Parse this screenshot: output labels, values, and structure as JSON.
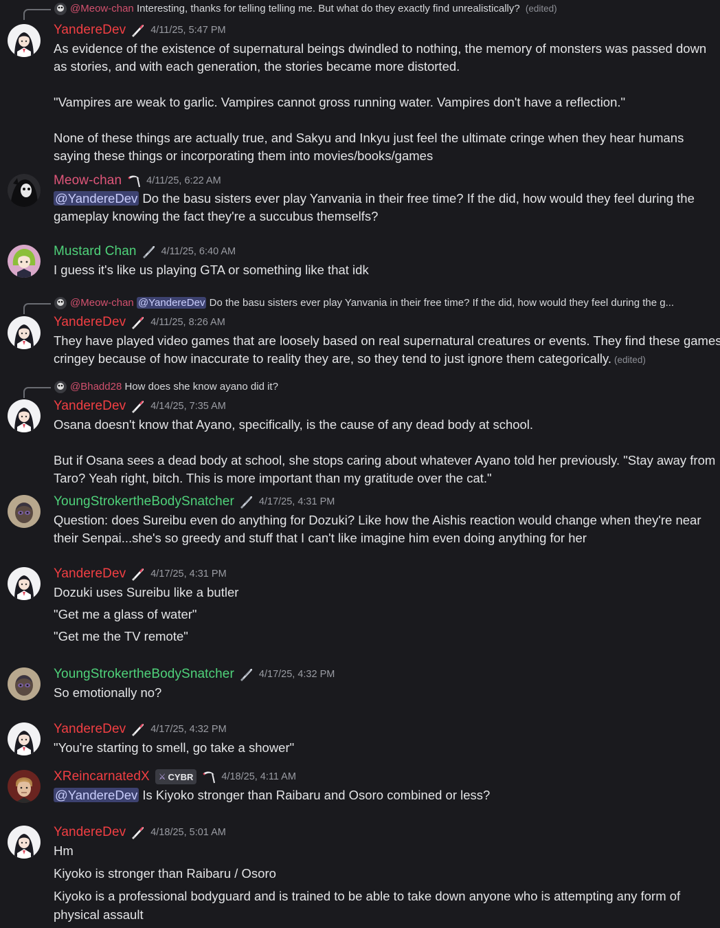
{
  "colors": {
    "yanderedev": "#f23f43",
    "meowchan": "#e0567a",
    "mustard": "#4fd27a",
    "youngstroker": "#4fd27a",
    "xreincarnated": "#f23f43",
    "mention_bg": "#3d4270"
  },
  "replies": [
    {
      "name": "@Meow-chan",
      "text": "Interesting, thanks for telling telling me. But what do they exactly find unrealistically?",
      "edited": "(edited)"
    },
    {
      "name": "@Meow-chan",
      "mention": "@YandereDev",
      "text": "Do the basu sisters ever play Yanvania in their free time? If the did, how would they feel during the g..."
    },
    {
      "name": "@Bhadd28",
      "text": "How does she know ayano did it?"
    }
  ],
  "messages": [
    {
      "author": "YandereDev",
      "role_icon": "knife-icon",
      "time": "4/11/25, 5:47 PM",
      "lines": [
        "As evidence of the existence of supernatural beings dwindled to nothing, the memory of monsters was passed down",
        "as stories, and with each generation, the stories became more distorted.",
        "\"Vampires are weak to garlic. Vampires cannot gross running water. Vampires don't have a reflection.\"",
        "None of these things are actually true, and Sakyu and Inkyu just feel the ultimate cringe when they hear humans",
        "saying these things or incorporating them into movies/books/games"
      ]
    },
    {
      "author": "Meow-chan",
      "role_icon": "scythe-icon",
      "time": "4/11/25, 6:22 AM",
      "mention": "@YandereDev",
      "lines": [
        "Do the basu sisters ever play Yanvania in their free time? If the did, how would they feel during the",
        "gameplay knowing the fact they're a succubus themselfs?"
      ]
    },
    {
      "author": "Mustard Chan",
      "role_icon": "dagger-icon",
      "time": "4/11/25, 6:40 AM",
      "lines": [
        "I guess it's like us playing GTA or something like that idk"
      ]
    },
    {
      "author": "YandereDev",
      "role_icon": "knife-icon",
      "time": "4/11/25, 8:26 AM",
      "lines": [
        "They have played video games that are loosely based on real supernatural creatures or events. They find these games",
        "cringey because of how inaccurate to reality they are, so they tend to just ignore them categorically."
      ],
      "edited": "(edited)"
    },
    {
      "author": "YandereDev",
      "role_icon": "knife-icon",
      "time": "4/14/25, 7:35 AM",
      "lines": [
        "Osana doesn't know that Ayano, specifically, is the cause of any dead body at school.",
        "But if Osana sees a dead body at school, she stops caring about whatever Ayano told her previously. \"Stay away from",
        "Taro? Yeah right, bitch. This is more important than my gratitude over the cat.\""
      ]
    },
    {
      "author": "YoungStrokertheBodySnatcher",
      "role_icon": "dagger-icon",
      "time": "4/17/25, 4:31 PM",
      "lines": [
        "Question: does Sureibu even do anything for Dozuki? Like how the Aishis reaction would change when they're near",
        "their Senpai...she's so greedy and stuff that I can't like imagine him even doing anything for her"
      ]
    },
    {
      "author": "YandereDev",
      "role_icon": "knife-icon",
      "time": "4/17/25, 4:31 PM",
      "lines": [
        "Dozuki uses Sureibu like a butler",
        "\"Get me a glass of water\"",
        "\"Get me the TV remote\""
      ]
    },
    {
      "author": "YoungStrokertheBodySnatcher",
      "role_icon": "dagger-icon",
      "time": "4/17/25, 4:32 PM",
      "lines": [
        "So emotionally no?"
      ]
    },
    {
      "author": "YandereDev",
      "role_icon": "knife-icon",
      "time": "4/17/25, 4:32 PM",
      "lines": [
        "\"You're starting to smell, go take a shower\""
      ]
    },
    {
      "author": "XReincarnatedX",
      "tag": "CYBR",
      "role_icon": "scythe-icon",
      "time": "4/18/25, 4:11 AM",
      "mention": "@YandereDev",
      "lines": [
        "Is Kiyoko stronger than Raibaru and Osoro combined or less?"
      ]
    },
    {
      "author": "YandereDev",
      "role_icon": "knife-icon",
      "time": "4/18/25, 5:01 AM",
      "lines": [
        "Hm",
        "Kiyoko is stronger than Raibaru / Osoro",
        "Kiyoko is a professional bodyguard and is trained to be able to take down anyone who is attempting any form of",
        "physical assault"
      ]
    }
  ]
}
